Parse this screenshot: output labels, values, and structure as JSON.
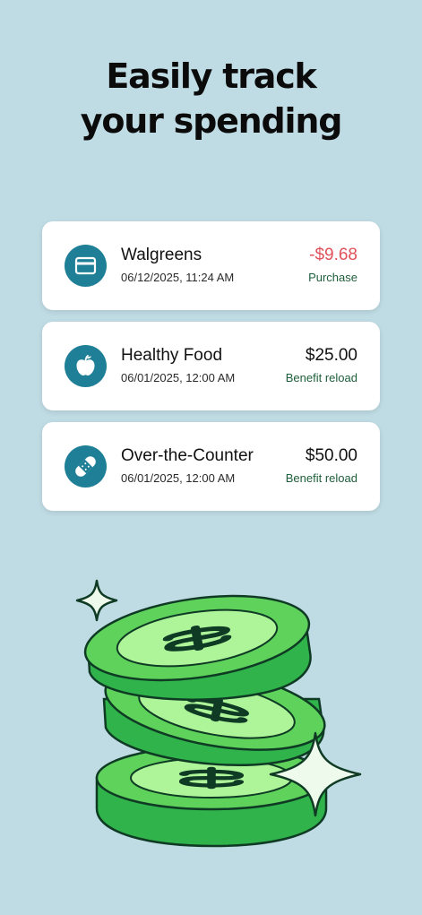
{
  "headline": {
    "line1": "Easily track",
    "line2": "your spending"
  },
  "transactions": [
    {
      "name": "Walgreens",
      "date": "06/12/2025, 11:24 AM",
      "amount": "-$9.68",
      "type": "Purchase",
      "icon": "credit-card-icon"
    },
    {
      "name": "Healthy Food",
      "date": "06/01/2025, 12:00 AM",
      "amount": "$25.00",
      "type": "Benefit reload",
      "icon": "apple-icon"
    },
    {
      "name": "Over-the-Counter",
      "date": "06/01/2025, 12:00 AM",
      "amount": "$50.00",
      "type": "Benefit reload",
      "icon": "bandage-icon"
    }
  ],
  "colors": {
    "background": "#bfdbe3",
    "icon_circle": "#1e7f96",
    "negative_amount": "#e0525a",
    "type_label": "#1d5f3a",
    "coin_green": "#34c24a",
    "coin_light": "#8fef74"
  },
  "illustration": {
    "subject": "stack-of-three-dollar-coins-with-sparkles"
  }
}
